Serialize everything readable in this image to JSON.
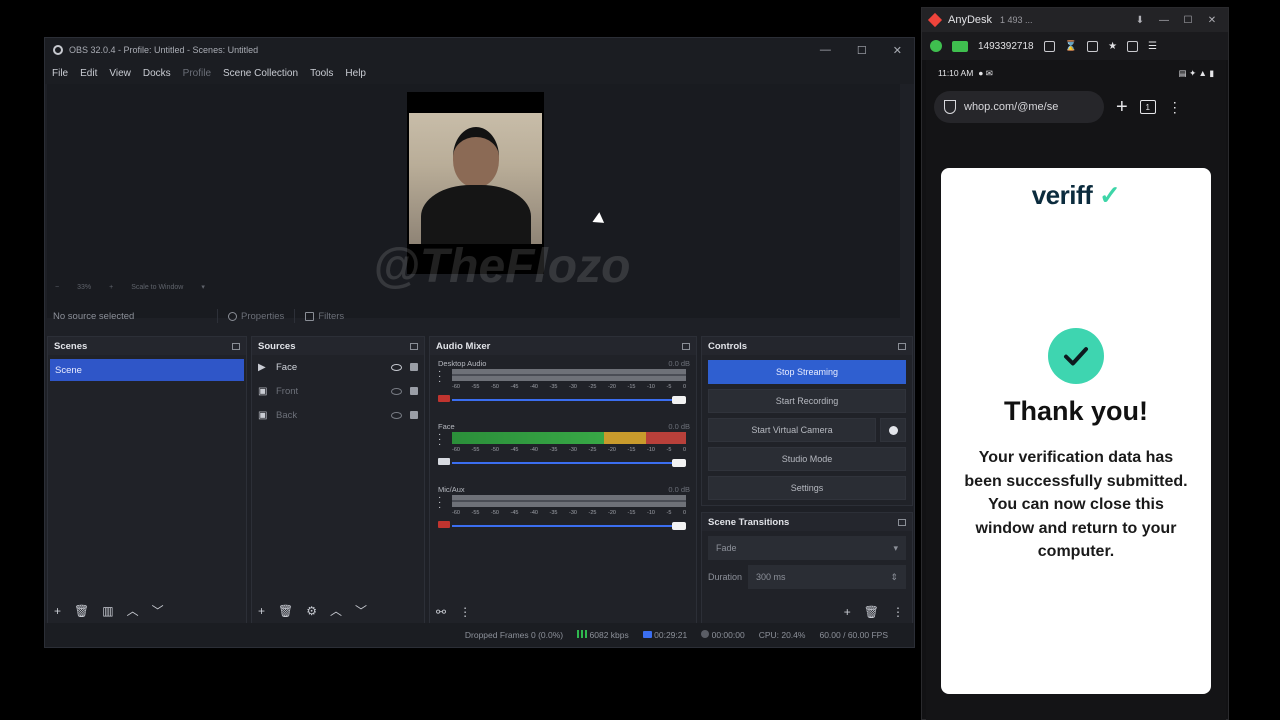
{
  "obs": {
    "window_title": "OBS 32.0.4 - Profile: Untitled - Scenes: Untitled",
    "menu": [
      "File",
      "Edit",
      "View",
      "Docks",
      "Profile",
      "Scene Collection",
      "Tools",
      "Help"
    ],
    "zoom": "33%",
    "scale_mode": "Scale to Window",
    "no_source": "No source selected",
    "properties_label": "Properties",
    "filters_label": "Filters",
    "watermark": "@TheFlozo",
    "scenes": {
      "title": "Scenes",
      "items": [
        "Scene"
      ]
    },
    "sources": {
      "title": "Sources",
      "items": [
        {
          "name": "Face",
          "active": true
        },
        {
          "name": "Front",
          "active": false
        },
        {
          "name": "Back",
          "active": false
        }
      ]
    },
    "mixer": {
      "title": "Audio Mixer",
      "ticks": [
        "-60",
        "-55",
        "-50",
        "-45",
        "-40",
        "-35",
        "-30",
        "-25",
        "-20",
        "-15",
        "-10",
        "-5",
        "0"
      ],
      "channels": [
        {
          "name": "Desktop Audio",
          "db": "0.0 dB",
          "muted": true,
          "level": 0
        },
        {
          "name": "Face",
          "db": "0.0 dB",
          "muted": false,
          "level": 1.0
        },
        {
          "name": "Mic/Aux",
          "db": "0.0 dB",
          "muted": true,
          "level": 0
        }
      ]
    },
    "controls": {
      "title": "Controls",
      "stop_streaming": "Stop Streaming",
      "start_recording": "Start Recording",
      "start_virtual_camera": "Start Virtual Camera",
      "studio_mode": "Studio Mode",
      "settings": "Settings"
    },
    "transitions": {
      "title": "Scene Transitions",
      "selected": "Fade",
      "duration_label": "Duration",
      "duration_value": "300 ms"
    },
    "status": {
      "dropped": "Dropped Frames 0 (0.0%)",
      "bitrate": "6082 kbps",
      "stream_time": "00:29:21",
      "rec_time": "00:00:00",
      "cpu": "CPU: 20.4%",
      "fps": "60.00 / 60.00 FPS"
    }
  },
  "anydesk": {
    "title": "AnyDesk",
    "session_id": "1 493 ...",
    "address": "1493392718",
    "phone": {
      "time": "11:10 AM",
      "url": "whop.com/@me/se",
      "tab_count": "1",
      "brand": "veriff",
      "heading": "Thank you!",
      "message": "Your verification data has been successfully submitted. You can now close this window and return to your computer."
    }
  },
  "colors": {
    "accent_blue": "#2f5fd0",
    "veriff_green": "#3ed5b0",
    "anydesk_red": "#ef443b"
  }
}
